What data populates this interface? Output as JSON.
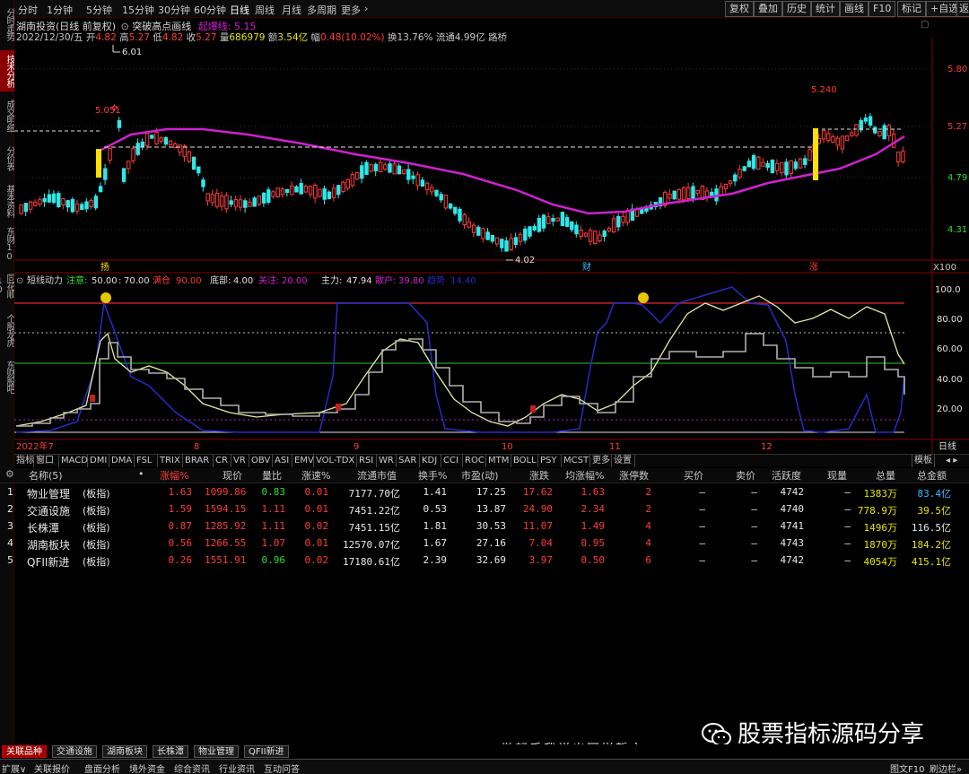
{
  "sidebar": {
    "items": [
      {
        "label": "分时走势",
        "active": false
      },
      {
        "label": "技术分析",
        "active": true
      },
      {
        "label": "成交明细",
        "active": false
      },
      {
        "label": "分价表",
        "active": false
      },
      {
        "label": "基本资料",
        "active": false
      },
      {
        "label": "东财10",
        "active": false
      },
      {
        "label": "同花顺10",
        "active": false
      },
      {
        "label": "个股龙虎",
        "active": false
      },
      {
        "label": "东财股吧",
        "active": false
      }
    ]
  },
  "toolbar": {
    "periods": [
      "分时",
      "1分钟",
      "5分钟",
      "15分钟",
      "30分钟",
      "60分钟",
      "日线",
      "周线",
      "月线",
      "多周期",
      "更多"
    ],
    "active_period": "日线",
    "buttons": [
      "复权",
      "叠加",
      "历史",
      "统计",
      "画线",
      "F10",
      "标记",
      "+自选",
      "返回"
    ]
  },
  "chart_header": {
    "stock_name": "湖南投资(日线 前复权)",
    "indicator_name": "突破高点画线",
    "indicator_param_label": "起爆线:",
    "indicator_param_value": "5.15",
    "date": "2022/12/30/五",
    "open_label": "开",
    "open": "4.82",
    "high_label": "高",
    "high": "5.27",
    "low_label": "低",
    "low": "4.82",
    "close_label": "收",
    "close": "5.27",
    "volume_label": "量",
    "volume": "686979",
    "amount_label": "额",
    "amount": "3.54亿",
    "change_label": "幅",
    "change": "0.48(10.02%)",
    "turnover_label": "换",
    "turnover": "13.76%",
    "float_label": "流通",
    "float": "4.99亿",
    "tail": "路桥"
  },
  "price_axis": [
    "5.80",
    "5.27",
    "4.79",
    "4.31"
  ],
  "price_annotations": {
    "high": "6.01",
    "left_mark": "5.051",
    "right_mark": "5.240",
    "low": "4.02"
  },
  "event_markers": [
    "扬",
    "财",
    "涨"
  ],
  "zoom_label": "X100",
  "indicator_header": {
    "name": "短线动力",
    "attention_label": "注意:",
    "attention_value": "50.00",
    "sep_value": "70.00",
    "full_label": "满仓",
    "full_value": "90.00",
    "bottom_label": "底部:",
    "bottom_value": "4.00",
    "focus_label": "关注:",
    "focus_value": "20.00",
    "main_label": "主力:",
    "main_value": "47.94",
    "retail_label": "散户:",
    "retail_value": "39.80",
    "extra_label": "趋势",
    "extra_value": "14.40"
  },
  "indicator_axis": [
    "100.0",
    "80.00",
    "60.00",
    "40.00",
    "20.00"
  ],
  "date_axis": [
    "2022年7",
    "8",
    "9",
    "10",
    "11",
    "12"
  ],
  "date_axis_right": "日线",
  "indicator_tabs": [
    "指标",
    "窗口",
    "MACD",
    "DMI",
    "DMA",
    "FSL",
    "TRIX",
    "BRAR",
    "CR",
    "VR",
    "OBV",
    "ASI",
    "EMV",
    "VOL-TDX",
    "RSI",
    "WR",
    "SAR",
    "KDJ",
    "CCI",
    "ROC",
    "MTM",
    "BOLL",
    "PSY",
    "MCST",
    "更多",
    "设置"
  ],
  "indicator_tabs_right": "模板",
  "table": {
    "gear_icon": "gear-icon",
    "headers": [
      "名称(5)",
      "•",
      "涨幅%",
      "现价",
      "量比",
      "涨速%",
      "流通市值",
      "换手%",
      "市盈(动)",
      "涨跌",
      "均涨幅%",
      "涨停数",
      "买价",
      "卖价",
      "活跃度",
      "现量",
      "总量",
      "总金额"
    ],
    "rows": [
      {
        "idx": "1",
        "name": "物业管理",
        "tag": "(板指)",
        "chg": "1.63",
        "price": "1099.86",
        "vr": "0.83",
        "spd": "0.01",
        "mcap": "7177.70亿",
        "turn": "1.41",
        "pe": "17.25",
        "diff": "17.62",
        "avg": "1.63",
        "lim": "2",
        "bid": "—",
        "ask": "—",
        "act": "4742",
        "cur": "—",
        "vol": "1383万",
        "amt": "83.4亿"
      },
      {
        "idx": "2",
        "name": "交通设施",
        "tag": "(板指)",
        "chg": "1.59",
        "price": "1594.15",
        "vr": "1.11",
        "spd": "0.01",
        "mcap": "7451.22亿",
        "turn": "0.53",
        "pe": "13.87",
        "diff": "24.90",
        "avg": "2.34",
        "lim": "2",
        "bid": "—",
        "ask": "—",
        "act": "4740",
        "cur": "—",
        "vol": "778.9万",
        "amt": "39.5亿"
      },
      {
        "idx": "3",
        "name": "长株潭",
        "tag": "(板指)",
        "chg": "0.87",
        "price": "1285.92",
        "vr": "1.11",
        "spd": "0.02",
        "mcap": "7451.15亿",
        "turn": "1.81",
        "pe": "30.53",
        "diff": "11.07",
        "avg": "1.49",
        "lim": "4",
        "bid": "—",
        "ask": "—",
        "act": "4741",
        "cur": "—",
        "vol": "1496万",
        "amt": "116.5亿"
      },
      {
        "idx": "4",
        "name": "湖南板块",
        "tag": "(板指)",
        "chg": "0.56",
        "price": "1266.55",
        "vr": "1.07",
        "spd": "0.01",
        "mcap": "12570.07亿",
        "turn": "1.67",
        "pe": "27.16",
        "diff": "7.04",
        "avg": "0.95",
        "lim": "4",
        "bid": "—",
        "ask": "—",
        "act": "4743",
        "cur": "—",
        "vol": "1870万",
        "amt": "184.2亿"
      },
      {
        "idx": "5",
        "name": "QFII新进",
        "tag": "(板指)",
        "chg": "0.26",
        "price": "1551.91",
        "vr": "0.96",
        "spd": "0.02",
        "mcap": "17180.61亿",
        "turn": "2.39",
        "pe": "32.69",
        "diff": "3.97",
        "avg": "0.50",
        "lim": "6",
        "bid": "—",
        "ask": "—",
        "act": "4742",
        "cur": "—",
        "vol": "4054万",
        "amt": "415.1亿"
      }
    ]
  },
  "bottom_tabs": [
    {
      "label": "关联品种",
      "active": true
    },
    {
      "label": "交通设施",
      "active": false
    },
    {
      "label": "湖南板块",
      "active": false
    },
    {
      "label": "长株潭",
      "active": false
    },
    {
      "label": "物业管理",
      "active": false
    },
    {
      "label": "QFII新进",
      "active": false
    }
  ],
  "bottom_bar": [
    "扩展∨",
    "关联报价",
    "盘面分析",
    "境外资金",
    "综合资讯",
    "行业资讯",
    "互动问答"
  ],
  "bottom_bar_right": [
    "图文F10",
    "刷边栏»"
  ],
  "watermark": "股票指标源码分享",
  "slogan": "举起手我说出同样誓言",
  "colors": {
    "up": "#ff3b3b",
    "down": "#2ee02e",
    "accent": "#a00000",
    "ma_line": "#d020d0",
    "indicator_main": "#e8e8a0",
    "indicator_blue": "#2a2ac8"
  }
}
